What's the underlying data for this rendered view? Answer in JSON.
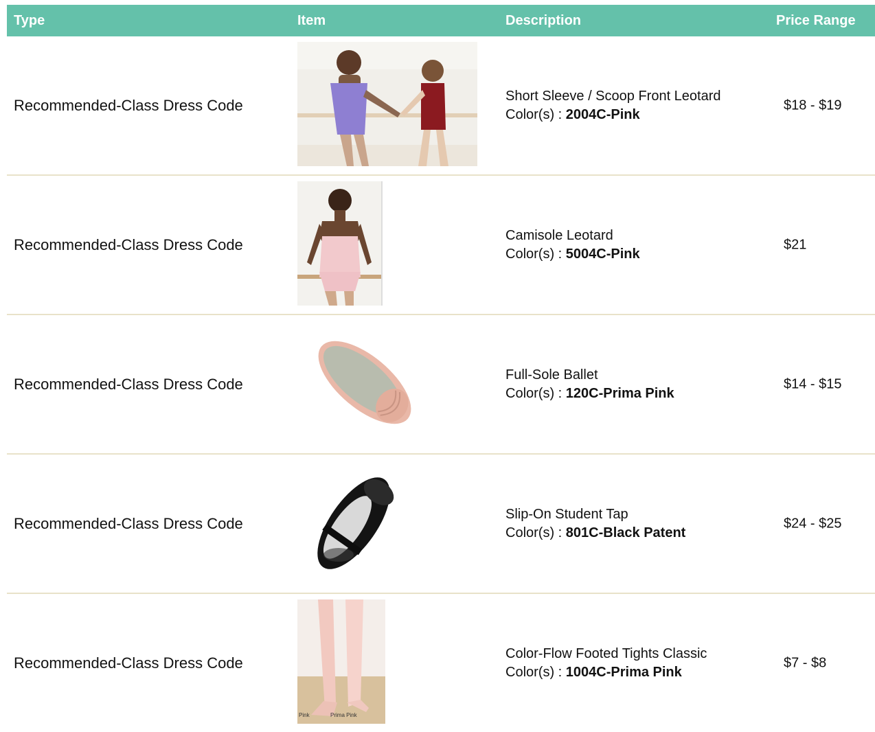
{
  "header": {
    "type": "Type",
    "item": "Item",
    "description": "Description",
    "price": "Price Range"
  },
  "colors_label": "Color(s) : ",
  "rows": [
    {
      "type": "Recommended-Class Dress Code",
      "name": "Short Sleeve / Scoop Front Leotard",
      "color": "2004C-Pink",
      "price": "$18 - $19",
      "image": "leotard-girls-photo"
    },
    {
      "type": "Recommended-Class Dress Code",
      "name": "Camisole Leotard",
      "color": "5004C-Pink",
      "price": "$21",
      "image": "camisole-leotard-photo"
    },
    {
      "type": "Recommended-Class Dress Code",
      "name": "Full-Sole Ballet",
      "color": "120C-Prima Pink",
      "price": "$14 - $15",
      "image": "ballet-shoe-photo"
    },
    {
      "type": "Recommended-Class Dress Code",
      "name": "Slip-On Student Tap",
      "color": "801C-Black Patent",
      "price": "$24 - $25",
      "image": "tap-shoe-photo"
    },
    {
      "type": "Recommended-Class Dress Code",
      "name": "Color-Flow Footed Tights Classic",
      "color": "1004C-Prima Pink",
      "price": "$7 - $8",
      "image": "tights-photo",
      "image_captions": [
        "Pink",
        "Prima Pink"
      ]
    }
  ],
  "colors": {
    "header_bg": "#64c1aa",
    "row_divider": "#e8e2c9"
  }
}
